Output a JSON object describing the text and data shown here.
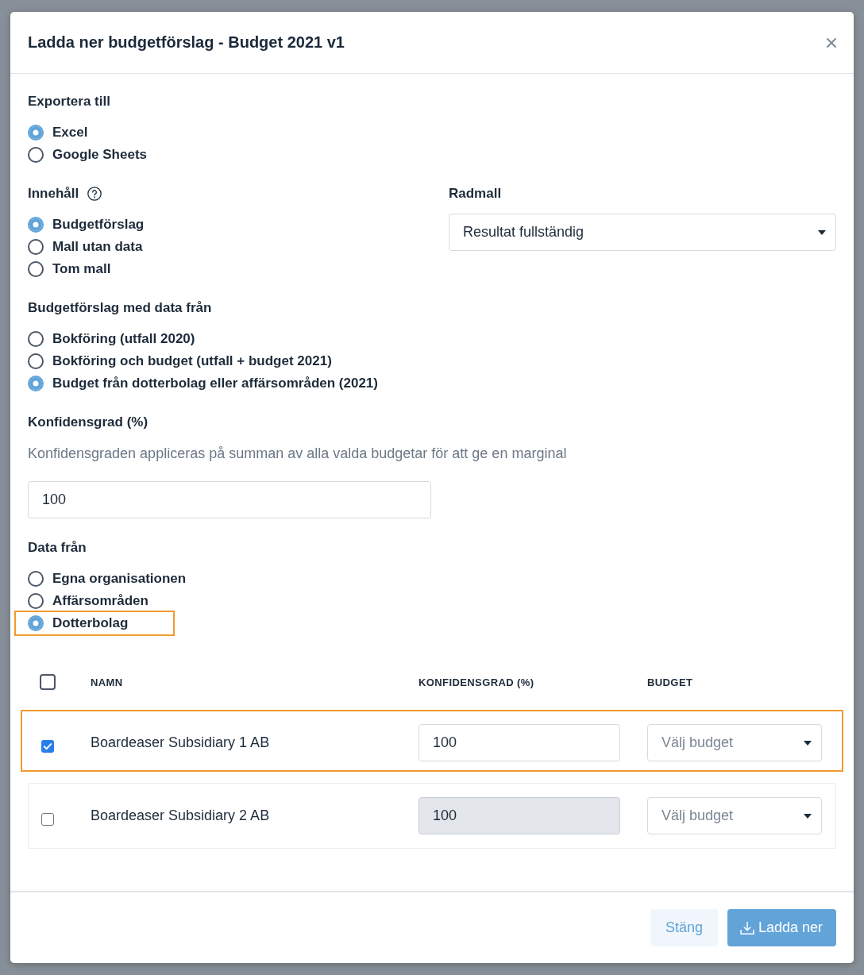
{
  "dialog": {
    "title": "Ladda ner budgetförslag - Budget 2021 v1"
  },
  "export_to": {
    "label": "Exportera till",
    "options": [
      {
        "label": "Excel",
        "selected": true
      },
      {
        "label": "Google Sheets",
        "selected": false
      }
    ]
  },
  "content": {
    "label": "Innehåll",
    "options": [
      {
        "label": "Budgetförslag",
        "selected": true
      },
      {
        "label": "Mall utan data",
        "selected": false
      },
      {
        "label": "Tom mall",
        "selected": false
      }
    ]
  },
  "row_template": {
    "label": "Radmall",
    "value": "Resultat fullständig"
  },
  "data_source": {
    "label": "Budgetförslag med data från",
    "options": [
      {
        "label": "Bokföring (utfall 2020)",
        "selected": false
      },
      {
        "label": "Bokföring och budget (utfall + budget 2021)",
        "selected": false
      },
      {
        "label": "Budget från dotterbolag eller affärsområden (2021)",
        "selected": true
      }
    ]
  },
  "confidence": {
    "label": "Konfidensgrad (%)",
    "help": "Konfidensgraden appliceras på summan av alla valda budgetar för att ge en marginal",
    "value": "100"
  },
  "data_from": {
    "label": "Data från",
    "options": [
      {
        "label": "Egna organisationen",
        "selected": false,
        "highlighted": false
      },
      {
        "label": "Affärsområden",
        "selected": false,
        "highlighted": false
      },
      {
        "label": "Dotterbolag",
        "selected": true,
        "highlighted": true
      }
    ]
  },
  "table": {
    "select_all": {
      "checked": false
    },
    "columns": [
      "NAMN",
      "KONFIDENSGRAD (%)",
      "BUDGET"
    ],
    "rows": [
      {
        "checked": true,
        "highlighted": true,
        "name": "Boardeaser Subsidiary 1 AB",
        "confidence": {
          "value": "100",
          "disabled": false
        },
        "budget": {
          "placeholder": "Välj budget"
        }
      },
      {
        "checked": false,
        "highlighted": false,
        "name": "Boardeaser Subsidiary 2 AB",
        "confidence": {
          "value": "100",
          "disabled": true
        },
        "budget": {
          "placeholder": "Välj budget"
        }
      }
    ]
  },
  "footer": {
    "buttons": [
      {
        "label": "Stäng",
        "kind": "secondary"
      },
      {
        "label": "Ladda ner",
        "kind": "primary"
      }
    ]
  }
}
